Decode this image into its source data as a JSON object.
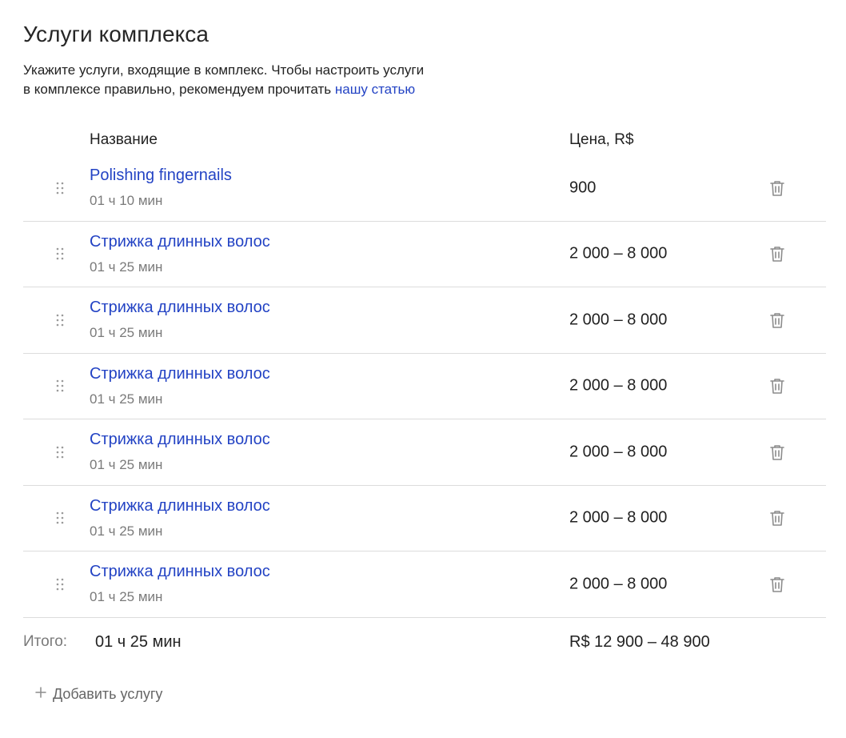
{
  "header": {
    "title": "Услуги комплекса",
    "description_line1": "Укажите услуги, входящие в комплекс. Чтобы настроить услуги",
    "description_line2": "в комплексе правильно, рекомендуем прочитать ",
    "article_link": "нашу статью"
  },
  "table": {
    "columns": {
      "name": "Название",
      "price": "Цена, R$"
    },
    "rows": [
      {
        "name": "Polishing fingernails",
        "duration": "01 ч 10 мин",
        "price": "900"
      },
      {
        "name": "Стрижка длинных волос",
        "duration": "01 ч 25 мин",
        "price": "2 000 – 8 000"
      },
      {
        "name": "Стрижка длинных волос",
        "duration": "01 ч 25 мин",
        "price": "2 000 – 8 000"
      },
      {
        "name": "Стрижка длинных волос",
        "duration": "01 ч 25 мин",
        "price": "2 000 – 8 000"
      },
      {
        "name": "Стрижка длинных волос",
        "duration": "01 ч 25 мин",
        "price": "2 000 – 8 000"
      },
      {
        "name": "Стрижка длинных волос",
        "duration": "01 ч 25 мин",
        "price": "2 000 – 8 000"
      },
      {
        "name": "Стрижка длинных волос",
        "duration": "01 ч 25 мин",
        "price": "2 000 – 8 000"
      }
    ]
  },
  "total": {
    "label": "Итого:",
    "duration": "01 ч 25 мин",
    "price": "R$ 12 900 – 48 900"
  },
  "add_button": {
    "label": "Добавить услугу"
  },
  "icons": {
    "drag": "drag-handle-icon",
    "delete": "trash-icon",
    "add": "plus-icon"
  },
  "colors": {
    "link": "#2343c4",
    "muted": "#7a7a7a",
    "divider": "#dcdcdc",
    "icon": "#8c8c8c"
  }
}
